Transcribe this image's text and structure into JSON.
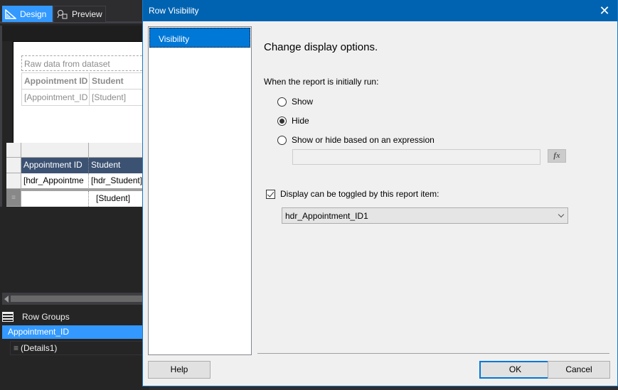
{
  "designer": {
    "tabs": [
      {
        "label": "Design",
        "icon": "ruler-triangle-icon",
        "active": true
      },
      {
        "label": "Preview",
        "icon": "preview-icon",
        "active": false
      }
    ],
    "page_title_textbox": "Raw data from dataset",
    "table1": {
      "headers": [
        "Appointment ID",
        "Student"
      ],
      "row": [
        "[Appointment_ID",
        "[Student]"
      ]
    },
    "table2": {
      "headers": [
        "Appointment ID",
        "Student"
      ],
      "group_row": [
        "[hdr_Appointme",
        "[hdr_Student]"
      ],
      "detail_row": [
        "",
        "[Student]"
      ]
    },
    "row_groups": {
      "title": "Row Groups",
      "items": [
        {
          "label": "Appointment_ID",
          "selected": true
        },
        {
          "label": "(Details1)",
          "selected": false
        }
      ]
    }
  },
  "dialog": {
    "title": "Row Visibility",
    "close_label": "✕",
    "nav_items": [
      {
        "label": "Visibility",
        "selected": true
      }
    ],
    "heading": "Change display options.",
    "initial_label": "When the report is initially run:",
    "options": [
      {
        "label": "Show",
        "checked": false
      },
      {
        "label": "Hide",
        "checked": true
      },
      {
        "label": "Show or hide based on an expression",
        "checked": false
      }
    ],
    "expression_value": "",
    "fx_label": "fx",
    "toggle_checkbox_label": "Display can be toggled by this report item:",
    "toggle_checked": true,
    "toggle_item_selected": "hdr_Appointment_ID1",
    "buttons": {
      "help": "Help",
      "ok": "OK",
      "cancel": "Cancel"
    }
  }
}
